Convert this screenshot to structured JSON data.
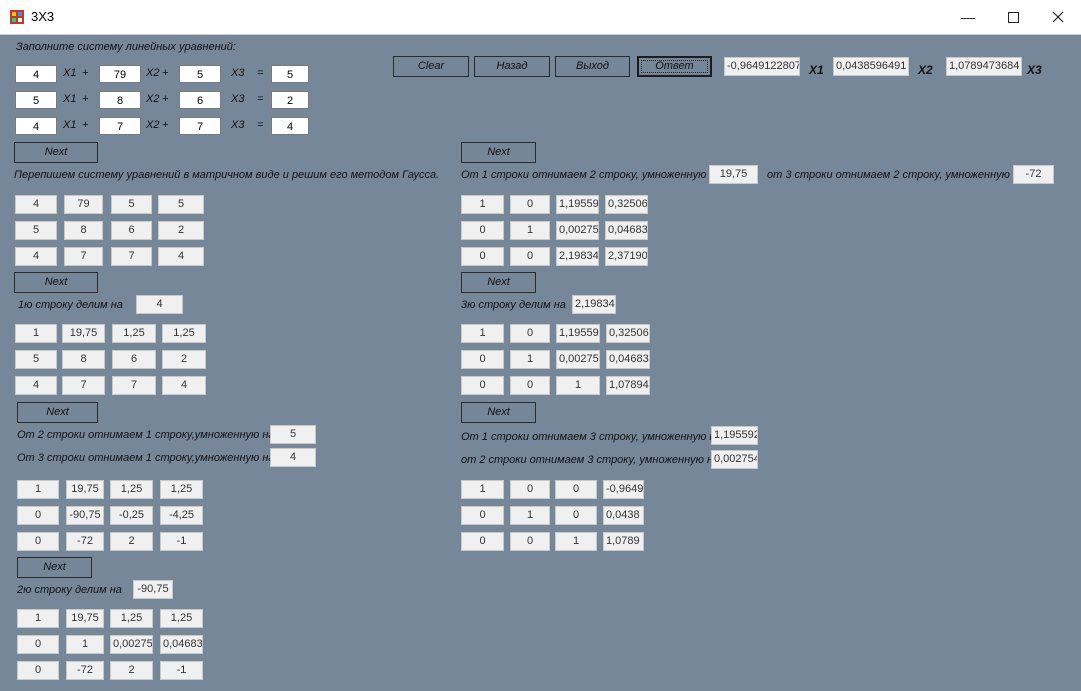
{
  "window": {
    "title": "3X3"
  },
  "prompt": "Заполните систему линейных уравнений:",
  "equations": [
    {
      "a1": "4",
      "a2": "79",
      "a3": "5",
      "b": "5"
    },
    {
      "a1": "5",
      "a2": "8",
      "a3": "6",
      "b": "2"
    },
    {
      "a1": "4",
      "a2": "7",
      "a3": "7",
      "b": "4"
    }
  ],
  "vars": {
    "x1": "X1",
    "x2": "X2",
    "x3": "X3",
    "plus": "+",
    "eq": "="
  },
  "toolbar": {
    "clear": "Clear",
    "back": "Назад",
    "exit": "Выход",
    "answer": "Ответ"
  },
  "answers": {
    "x1_value": "-0,9649122807",
    "x1_label": "X1",
    "x2_value": "0,0438596491",
    "x2_label": "X2",
    "x3_value": "1,0789473684",
    "x3_label": "X3"
  },
  "next_label": "Next",
  "left": {
    "step0_text": "Перепишем систему уравнений в матричном виде и решим его методом Гаусса.",
    "m0": [
      [
        "4",
        "79",
        "5",
        "5"
      ],
      [
        "5",
        "8",
        "6",
        "2"
      ],
      [
        "4",
        "7",
        "7",
        "4"
      ]
    ],
    "step1_text": "1ю строку делим на",
    "step1_val": "4",
    "m1": [
      [
        "1",
        "19,75",
        "1,25",
        "1,25"
      ],
      [
        "5",
        "8",
        "6",
        "2"
      ],
      [
        "4",
        "7",
        "7",
        "4"
      ]
    ],
    "step2_text_a": "От 2 строки отнимаем 1 строку,умноженную на",
    "step2_val_a": "5",
    "step2_text_b": "От 3 строки отнимаем 1 строку,умноженную на",
    "step2_val_b": "4",
    "m2": [
      [
        "1",
        "19,75",
        "1,25",
        "1,25"
      ],
      [
        "0",
        "-90,75",
        "-0,25",
        "-4,25"
      ],
      [
        "0",
        "-72",
        "2",
        "-1"
      ]
    ],
    "step3_text": "2ю строку делим на",
    "step3_val": "-90,75",
    "m3": [
      [
        "1",
        "19,75",
        "1,25",
        "1,25"
      ],
      [
        "0",
        "1",
        "0,00275",
        "0,04683"
      ],
      [
        "0",
        "-72",
        "2",
        "-1"
      ]
    ]
  },
  "right": {
    "step4_text_a": "От 1 строки отнимаем 2 строку, умноженную на",
    "step4_val_a": "19,75",
    "step4_text_b": "от 3 строки отнимаем 2 строку, умноженную на",
    "step4_val_b": "-72",
    "m4": [
      [
        "1",
        "0",
        "1,19559",
        "0,32506"
      ],
      [
        "0",
        "1",
        "0,00275",
        "0,04683"
      ],
      [
        "0",
        "0",
        "2,19834",
        "2,37190"
      ]
    ],
    "step5_text": "3ю строку делим на",
    "step5_val": "2,19834",
    "m5": [
      [
        "1",
        "0",
        "1,19559",
        "0,32506"
      ],
      [
        "0",
        "1",
        "0,00275",
        "0,04683"
      ],
      [
        "0",
        "0",
        "1",
        "1,07894"
      ]
    ],
    "step6_text_a": "От 1 строки отнимаем 3 строку, умноженную на",
    "step6_val_a": "1,195592",
    "step6_text_b": "от 2 строки отнимаем 3 строку, умноженную на",
    "step6_val_b": "0,002754",
    "m6": [
      [
        "1",
        "0",
        "0",
        "-0,9649"
      ],
      [
        "0",
        "1",
        "0",
        "0,0438"
      ],
      [
        "0",
        "0",
        "1",
        "1,0789"
      ]
    ]
  }
}
